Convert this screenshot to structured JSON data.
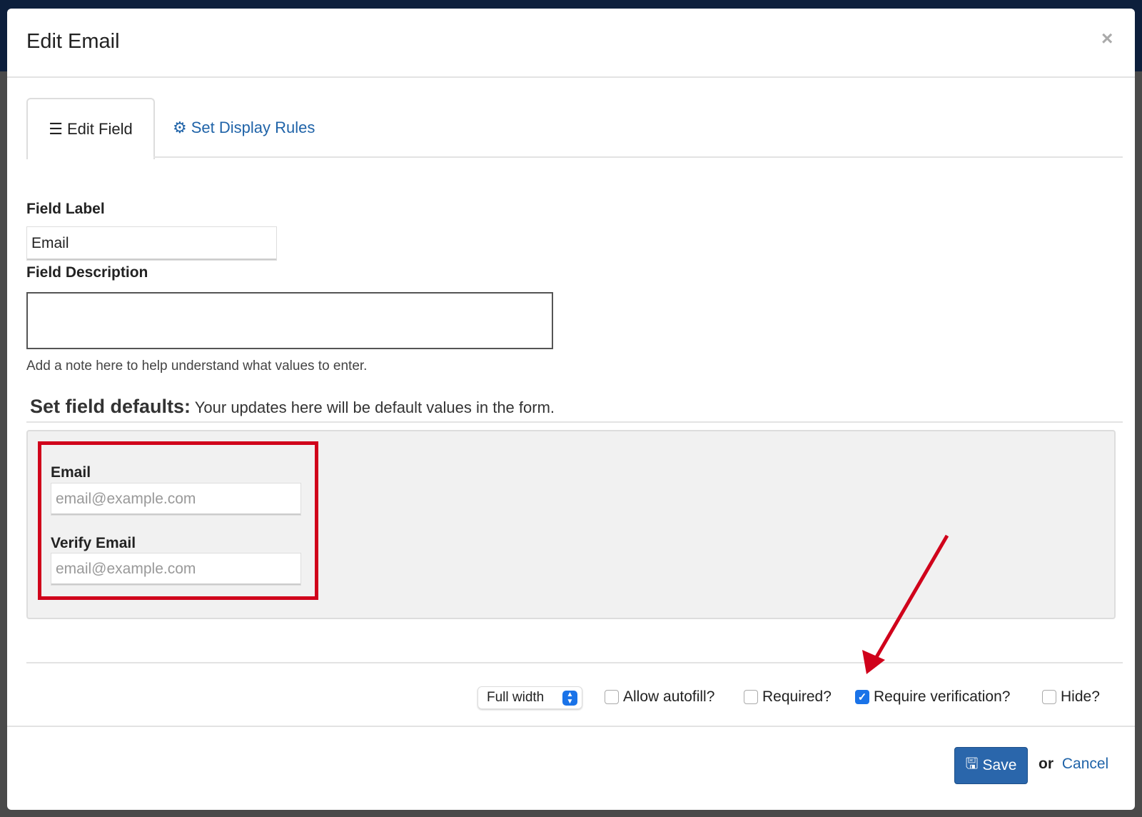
{
  "modal": {
    "title": "Edit Email"
  },
  "tabs": [
    {
      "label": "Edit Field",
      "icon": "list-icon",
      "active": true
    },
    {
      "label": "Set Display Rules",
      "icon": "gears-icon",
      "active": false
    }
  ],
  "form": {
    "field_label": "Field Label",
    "field_label_value": "Email",
    "field_description": "Field Description",
    "field_description_value": "",
    "description_help": "Add a note here to help understand what values to enter.",
    "defaults_heading": "Set field defaults:",
    "defaults_note": "Your updates here will be default values in the form.",
    "preview": {
      "email_label": "Email",
      "email_placeholder": "email@example.com",
      "verify_label": "Verify Email",
      "verify_placeholder": "email@example.com"
    }
  },
  "options": {
    "width_select": "Full width",
    "checkboxes": [
      {
        "label": "Allow autofill?",
        "checked": false
      },
      {
        "label": "Required?",
        "checked": false
      },
      {
        "label": "Require verification?",
        "checked": true
      },
      {
        "label": "Hide?",
        "checked": false
      }
    ]
  },
  "footer": {
    "save": "Save",
    "or": "or",
    "cancel": "Cancel"
  },
  "colors": {
    "accent": "#2a66ab",
    "link": "#1f63a8",
    "highlight": "#d0021b"
  }
}
